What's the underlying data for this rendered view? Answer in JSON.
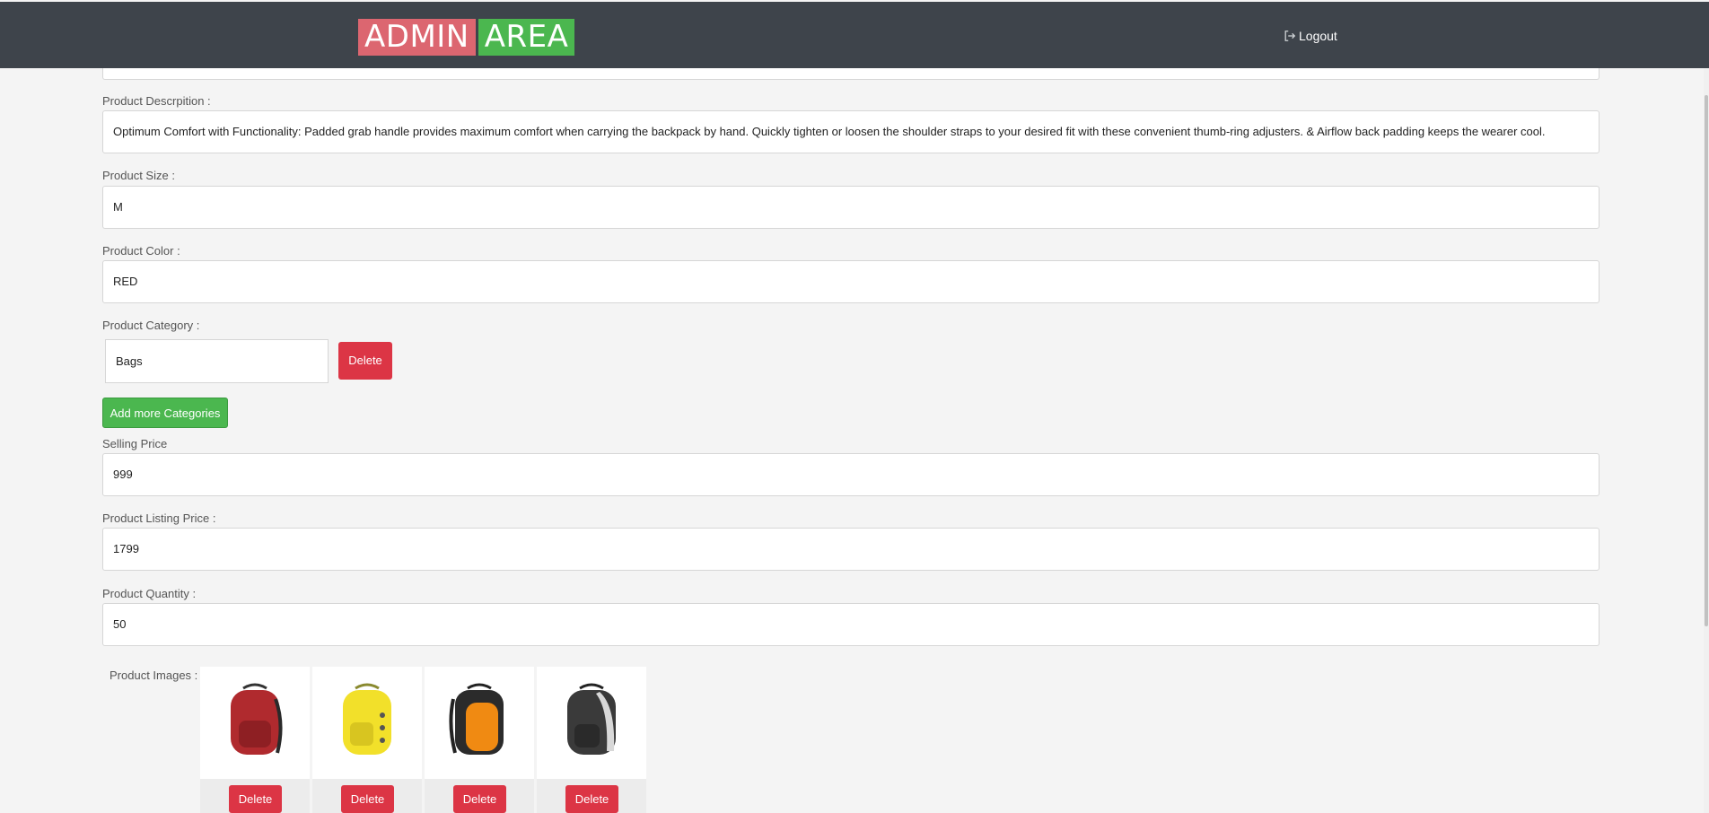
{
  "header": {
    "logo_left": "ADMIN",
    "logo_right": "AREA",
    "logout_label": "Logout"
  },
  "form": {
    "description": {
      "label": "Product Descrpition :",
      "value": "Optimum Comfort with Functionality: Padded grab handle provides maximum comfort when carrying the backpack by hand. Quickly tighten or loosen the shoulder straps to your desired fit with these convenient thumb-ring adjusters. & Airflow back padding keeps the wearer cool."
    },
    "size": {
      "label": "Product Size :",
      "value": "M"
    },
    "color": {
      "label": "Product Color :",
      "value": "RED"
    },
    "category": {
      "label": "Product Category :",
      "items": [
        {
          "value": "Bags",
          "delete_label": "Delete"
        }
      ],
      "add_label": "Add more Categories"
    },
    "selling_price": {
      "label": "Selling Price",
      "value": "999"
    },
    "listing_price": {
      "label": "Product Listing Price :",
      "value": "1799"
    },
    "quantity": {
      "label": "Product Quantity :",
      "value": "50"
    },
    "images": {
      "label": "Product Images :",
      "items": [
        {
          "color": "#b02a2e",
          "delete_label": "Delete"
        },
        {
          "color": "#f2e02a",
          "delete_label": "Delete"
        },
        {
          "color": "#f08a12",
          "delete_label": "Delete"
        },
        {
          "color": "#3a3a3a",
          "delete_label": "Delete"
        }
      ]
    }
  },
  "colors": {
    "header_bg": "#3e444b",
    "logo_admin": "#dc6670",
    "logo_area": "#4bb74f",
    "danger": "#dc3545",
    "success": "#4bb74f"
  }
}
